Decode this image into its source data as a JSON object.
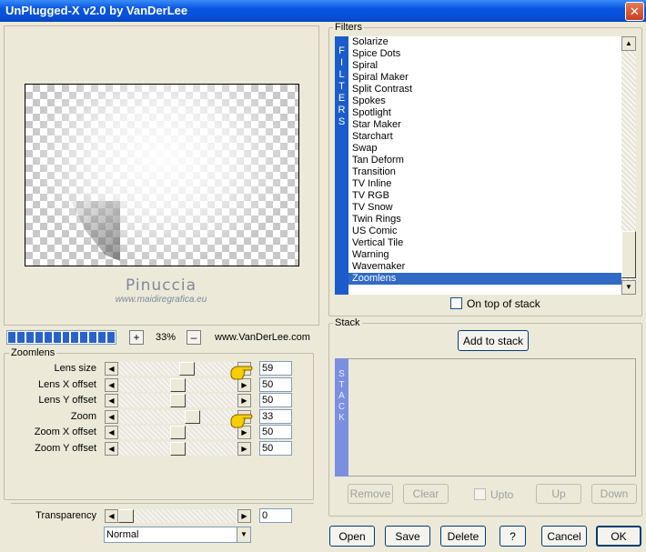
{
  "window": {
    "title": "UnPlugged-X v2.0 by VanDerLee",
    "close_glyph": "✕"
  },
  "preview": {
    "watermark_name": "Pinuccia",
    "watermark_site": "www.maidiregrafica.eu"
  },
  "toolbar": {
    "progress_segments": 12,
    "zoom_in_label": "+",
    "zoom_value": "33%",
    "zoom_out_label": "–",
    "website": "www.VanDerLee.com"
  },
  "params": {
    "group_label": "Zoomlens",
    "rows": [
      {
        "label": "Lens size",
        "value": "59",
        "level": 0.59
      },
      {
        "label": "Lens X offset",
        "value": "50",
        "level": 0.5
      },
      {
        "label": "Lens Y offset",
        "value": "50",
        "level": 0.5
      },
      {
        "label": "Zoom",
        "value": "33",
        "level": 0.64
      },
      {
        "label": "Zoom X offset",
        "value": "50",
        "level": 0.5
      },
      {
        "label": "Zoom Y offset",
        "value": "50",
        "level": 0.5
      }
    ],
    "transparency": {
      "label": "Transparency",
      "value": "0",
      "level": 0.0
    },
    "blend_mode": "Normal"
  },
  "filters": {
    "group_label": "Filters",
    "strip_letters": [
      "F",
      "I",
      "L",
      "T",
      "E",
      "R",
      "S"
    ],
    "items": [
      "Solarize",
      "Spice Dots",
      "Spiral",
      "Spiral Maker",
      "Split Contrast",
      "Spokes",
      "Spotlight",
      "Star Maker",
      "Starchart",
      "Swap",
      "Tan Deform",
      "Transition",
      "TV Inline",
      "TV RGB",
      "TV Snow",
      "Twin Rings",
      "US Comic",
      "Vertical Tile",
      "Warning",
      "Wavemaker",
      "Zoomlens"
    ],
    "selected": "Zoomlens",
    "on_top_label": "On top of stack"
  },
  "stack": {
    "group_label": "Stack",
    "add_label": "Add to stack",
    "strip_letters": [
      "S",
      "T",
      "A",
      "C",
      "K"
    ],
    "remove_label": "Remove",
    "clear_label": "Clear",
    "upto_label": "Upto",
    "up_label": "Up",
    "down_label": "Down"
  },
  "footer": {
    "open_label": "Open",
    "save_label": "Save",
    "delete_label": "Delete",
    "help_label": "?",
    "cancel_label": "Cancel",
    "ok_label": "OK"
  },
  "colors": {
    "title_bar": "#0450d8",
    "filter_strip": "#1a5ccc",
    "stack_strip": "#7b8fe0",
    "selection": "#316ac5"
  }
}
